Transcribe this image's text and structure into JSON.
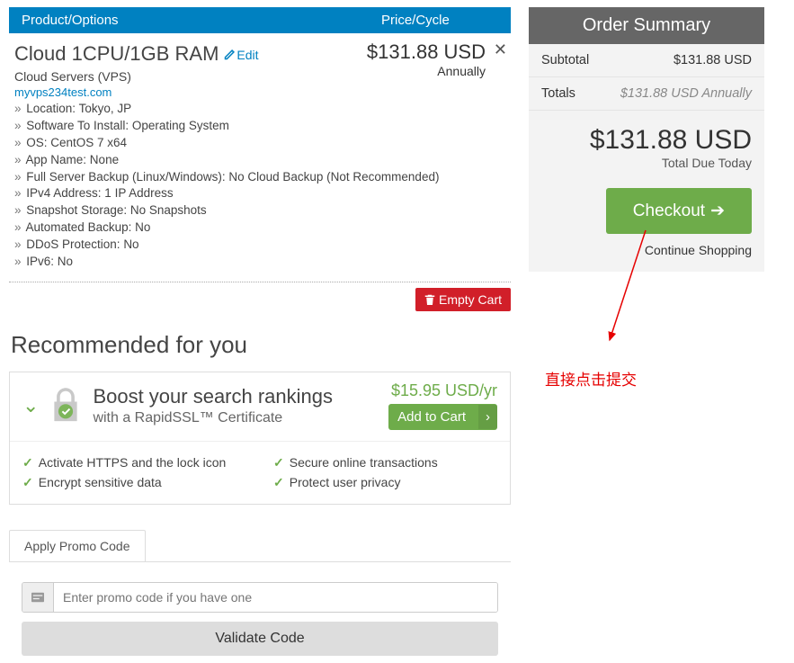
{
  "header": {
    "product": "Product/Options",
    "price": "Price/Cycle"
  },
  "item": {
    "title": "Cloud 1CPU/1GB RAM",
    "edit": "Edit",
    "price": "$131.88 USD",
    "cycle": "Annually",
    "group": "Cloud Servers (VPS)",
    "domain": "myvps234test.com",
    "configs": [
      "Location: Tokyo, JP",
      "Software To Install: Operating System",
      "OS: CentOS 7 x64",
      "App Name: None",
      "Full Server Backup (Linux/Windows): No Cloud Backup (Not Recommended)",
      "IPv4 Address: 1 IP Address",
      "Snapshot Storage: No Snapshots",
      "Automated Backup: No",
      "DDoS Protection: No",
      "IPv6: No"
    ]
  },
  "empty_cart": "Empty Cart",
  "recommend_heading": "Recommended for you",
  "promo": {
    "title": "Boost your search rankings",
    "sub": "with a RapidSSL™ Certificate",
    "price": "$15.95 USD/yr",
    "add": "Add to Cart",
    "features": {
      "col1": [
        "Activate HTTPS and the lock icon",
        "Encrypt sensitive data"
      ],
      "col2": [
        "Secure online transactions",
        "Protect user privacy"
      ]
    }
  },
  "promo_tab": "Apply Promo Code",
  "promo_placeholder": "Enter promo code if you have one",
  "validate": "Validate Code",
  "summary": {
    "title": "Order Summary",
    "subtotal_lbl": "Subtotal",
    "subtotal_val": "$131.88 USD",
    "totals_lbl": "Totals",
    "totals_val": "$131.88 USD Annually",
    "due_amt": "$131.88 USD",
    "due_lbl": "Total Due Today",
    "checkout": "Checkout",
    "continue": "Continue Shopping"
  },
  "annotation": "直接点击提交"
}
